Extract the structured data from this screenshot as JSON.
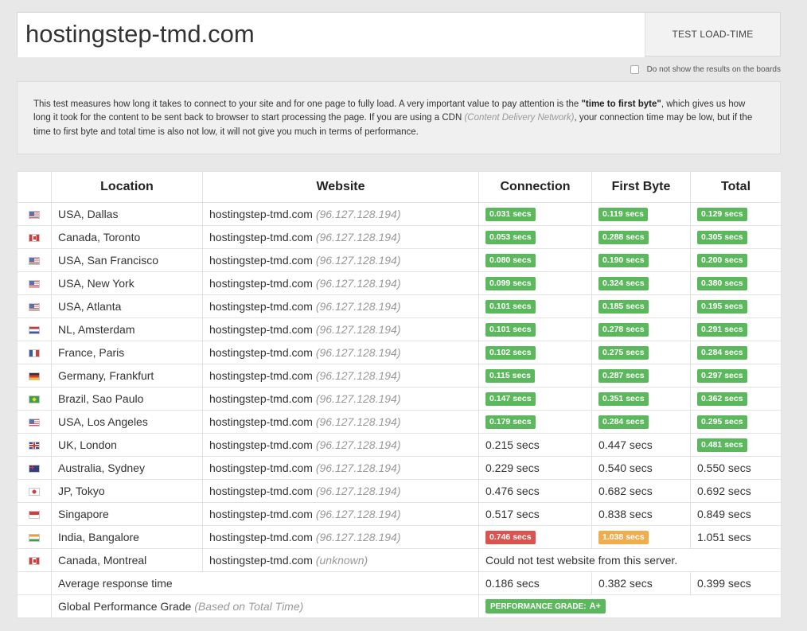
{
  "search": {
    "value": "hostingstep-tmd.com",
    "button_label": "TEST LOAD-TIME",
    "checkbox_label": "Do not show the results on the boards"
  },
  "info": {
    "text_1": "This test measures how long it takes to connect to your site and for one page to fully load. A very important value to pay attention is the ",
    "bold": "\"time to first byte\"",
    "text_2": ", which gives us how long it took for the content to be sent back to browser to start processing the page. If you are using a CDN ",
    "italic": "(Content Delivery Network)",
    "text_3": ", your connection time may be low, but if the time to first byte and total time is also not low, it will not give you much in terms of performance."
  },
  "table": {
    "headers": [
      "Location",
      "Website",
      "Connection",
      "First Byte",
      "Total"
    ],
    "rows": [
      {
        "flag": "flag-us",
        "location": "USA, Dallas",
        "site": "hostingstep-tmd.com",
        "ip": "(96.127.128.194)",
        "connection": "0.031 secs",
        "conn_style": "green",
        "first_byte": "0.119 secs",
        "fb_style": "green",
        "total": "0.129 secs",
        "total_style": "green"
      },
      {
        "flag": "flag-ca",
        "location": "Canada, Toronto",
        "site": "hostingstep-tmd.com",
        "ip": "(96.127.128.194)",
        "connection": "0.053 secs",
        "conn_style": "green",
        "first_byte": "0.288 secs",
        "fb_style": "green",
        "total": "0.305 secs",
        "total_style": "green"
      },
      {
        "flag": "flag-us",
        "location": "USA, San Francisco",
        "site": "hostingstep-tmd.com",
        "ip": "(96.127.128.194)",
        "connection": "0.080 secs",
        "conn_style": "green",
        "first_byte": "0.190 secs",
        "fb_style": "green",
        "total": "0.200 secs",
        "total_style": "green"
      },
      {
        "flag": "flag-us",
        "location": "USA, New York",
        "site": "hostingstep-tmd.com",
        "ip": "(96.127.128.194)",
        "connection": "0.099 secs",
        "conn_style": "green",
        "first_byte": "0.324 secs",
        "fb_style": "green",
        "total": "0.380 secs",
        "total_style": "green"
      },
      {
        "flag": "flag-us",
        "location": "USA, Atlanta",
        "site": "hostingstep-tmd.com",
        "ip": "(96.127.128.194)",
        "connection": "0.101 secs",
        "conn_style": "green",
        "first_byte": "0.185 secs",
        "fb_style": "green",
        "total": "0.195 secs",
        "total_style": "green"
      },
      {
        "flag": "flag-nl",
        "location": "NL, Amsterdam",
        "site": "hostingstep-tmd.com",
        "ip": "(96.127.128.194)",
        "connection": "0.101 secs",
        "conn_style": "green",
        "first_byte": "0.278 secs",
        "fb_style": "green",
        "total": "0.291 secs",
        "total_style": "green"
      },
      {
        "flag": "flag-fr",
        "location": "France, Paris",
        "site": "hostingstep-tmd.com",
        "ip": "(96.127.128.194)",
        "connection": "0.102 secs",
        "conn_style": "green",
        "first_byte": "0.275 secs",
        "fb_style": "green",
        "total": "0.284 secs",
        "total_style": "green"
      },
      {
        "flag": "flag-de",
        "location": "Germany, Frankfurt",
        "site": "hostingstep-tmd.com",
        "ip": "(96.127.128.194)",
        "connection": "0.115 secs",
        "conn_style": "green",
        "first_byte": "0.287 secs",
        "fb_style": "green",
        "total": "0.297 secs",
        "total_style": "green"
      },
      {
        "flag": "flag-br",
        "location": "Brazil, Sao Paulo",
        "site": "hostingstep-tmd.com",
        "ip": "(96.127.128.194)",
        "connection": "0.147 secs",
        "conn_style": "green",
        "first_byte": "0.351 secs",
        "fb_style": "green",
        "total": "0.362 secs",
        "total_style": "green"
      },
      {
        "flag": "flag-us",
        "location": "USA, Los Angeles",
        "site": "hostingstep-tmd.com",
        "ip": "(96.127.128.194)",
        "connection": "0.179 secs",
        "conn_style": "green",
        "first_byte": "0.284 secs",
        "fb_style": "green",
        "total": "0.295 secs",
        "total_style": "green"
      },
      {
        "flag": "flag-uk",
        "location": "UK, London",
        "site": "hostingstep-tmd.com",
        "ip": "(96.127.128.194)",
        "connection": "0.215 secs",
        "conn_style": "plain",
        "first_byte": "0.447 secs",
        "fb_style": "plain",
        "total": "0.481 secs",
        "total_style": "green"
      },
      {
        "flag": "flag-au",
        "location": "Australia, Sydney",
        "site": "hostingstep-tmd.com",
        "ip": "(96.127.128.194)",
        "connection": "0.229 secs",
        "conn_style": "plain",
        "first_byte": "0.540 secs",
        "fb_style": "plain",
        "total": "0.550 secs",
        "total_style": "plain"
      },
      {
        "flag": "flag-jp",
        "location": "JP, Tokyo",
        "site": "hostingstep-tmd.com",
        "ip": "(96.127.128.194)",
        "connection": "0.476 secs",
        "conn_style": "plain",
        "first_byte": "0.682 secs",
        "fb_style": "plain",
        "total": "0.692 secs",
        "total_style": "plain"
      },
      {
        "flag": "flag-sg",
        "location": "Singapore",
        "site": "hostingstep-tmd.com",
        "ip": "(96.127.128.194)",
        "connection": "0.517 secs",
        "conn_style": "plain",
        "first_byte": "0.838 secs",
        "fb_style": "plain",
        "total": "0.849 secs",
        "total_style": "plain"
      },
      {
        "flag": "flag-in",
        "location": "India, Bangalore",
        "site": "hostingstep-tmd.com",
        "ip": "(96.127.128.194)",
        "connection": "0.746 secs",
        "conn_style": "red",
        "first_byte": "1.038 secs",
        "fb_style": "orange",
        "total": "1.051 secs",
        "total_style": "plain"
      }
    ],
    "failed_row": {
      "flag": "flag-ca",
      "location": "Canada, Montreal",
      "site": "hostingstep-tmd.com",
      "ip": "(unknown)",
      "message": "Could not test website from this server."
    },
    "average": {
      "label": "Average response time",
      "connection": "0.186 secs",
      "first_byte": "0.382 secs",
      "total": "0.399 secs"
    },
    "grade": {
      "label": "Global Performance Grade",
      "note": "(Based on Total Time)",
      "badge_label": "PERFORMANCE GRADE:",
      "badge_value": "A+"
    }
  },
  "colors": {
    "green": "#5cb85c",
    "red": "#d9534f",
    "orange": "#f0ad4e"
  }
}
